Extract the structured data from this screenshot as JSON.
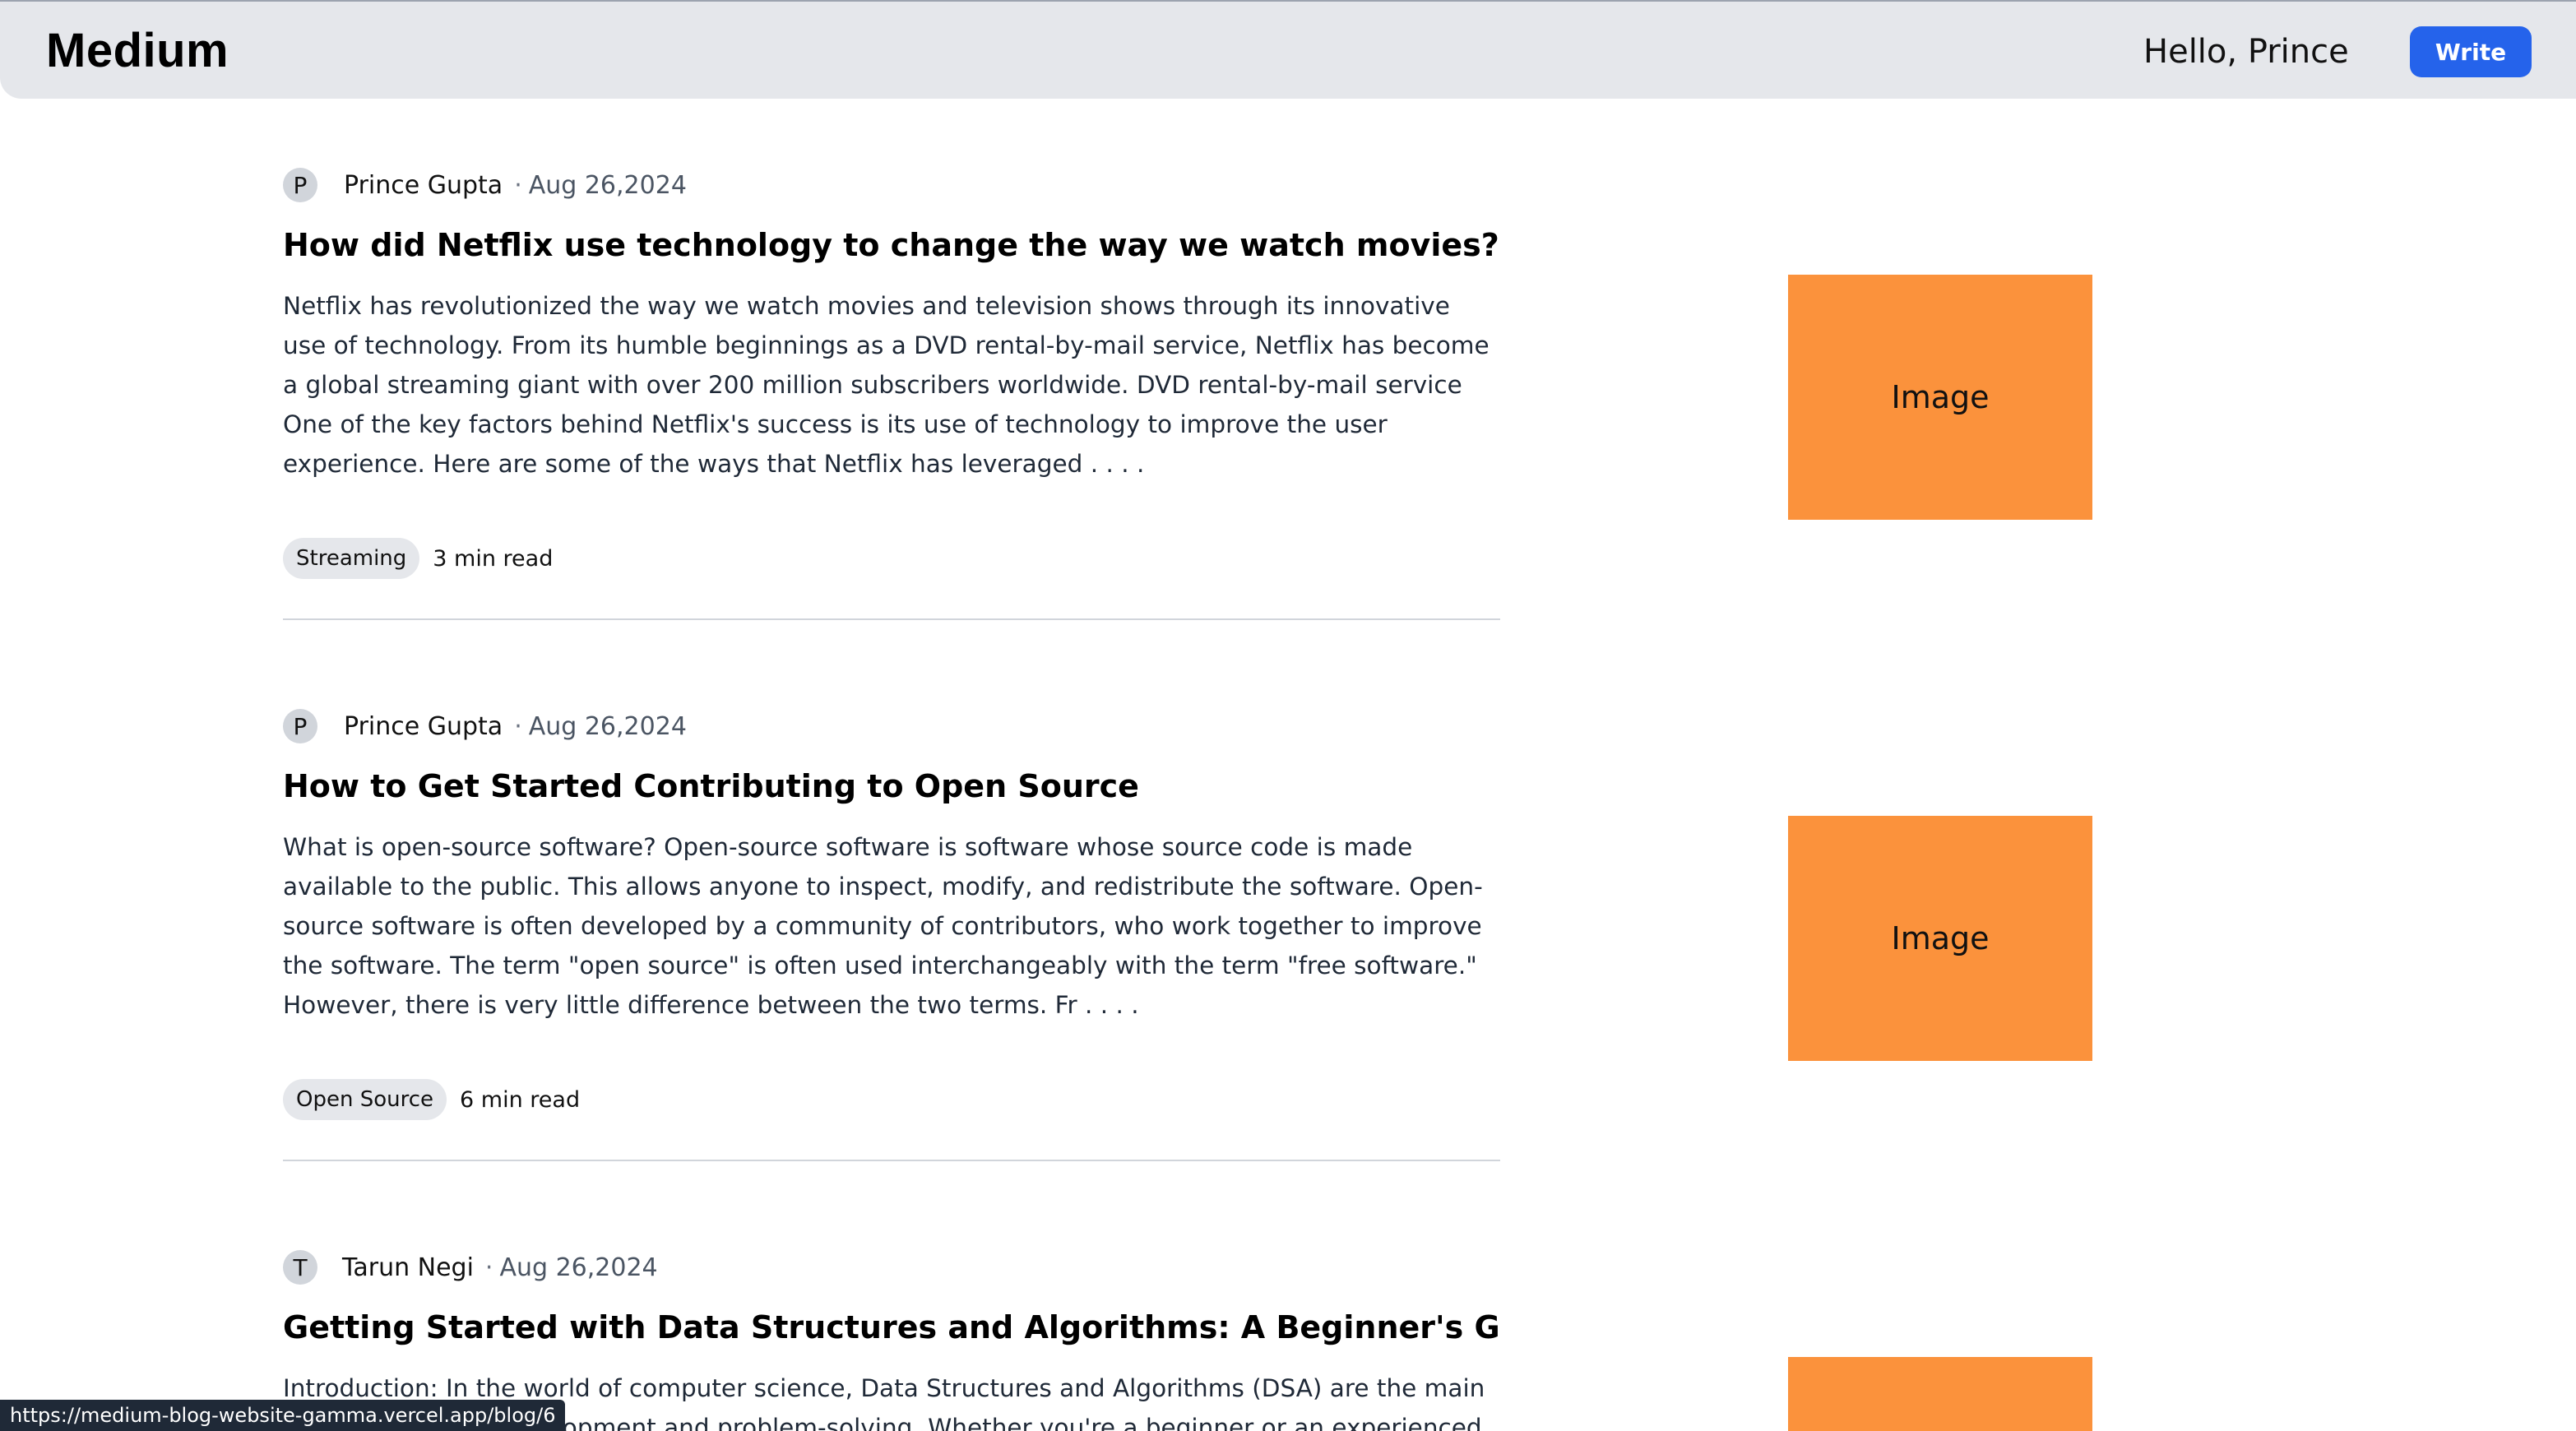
{
  "header": {
    "logo": "Medium",
    "greeting": "Hello, Prince",
    "write_label": "Write"
  },
  "posts": [
    {
      "avatar_initial": "P",
      "author": "Prince Gupta",
      "date": "Aug 26,2024",
      "title": "How did Netflix use technology to change the way we watch movies?",
      "excerpt": "Netflix has revolutionized the way we watch movies and television shows through its innovative use of technology. From its humble beginnings as a DVD rental-by-mail service, Netflix has become a global streaming giant with over 200 million subscribers worldwide. DVD rental-by-mail service One of the key factors behind Netflix's success is its use of technology to improve the user experience. Here are some of the ways that Netflix has leveraged . . . .",
      "tag": "Streaming",
      "read_time": "3 min read",
      "image_label": "Image"
    },
    {
      "avatar_initial": "P",
      "author": "Prince Gupta",
      "date": "Aug 26,2024",
      "title": "How to Get Started Contributing to Open Source",
      "excerpt": "What is open-source software? Open-source software is software whose source code is made available to the public. This allows anyone to inspect, modify, and redistribute the software. Open-source software is often developed by a community of contributors, who work together to improve the software. The term \"open source\" is often used interchangeably with the term \"free software.\" However, there is very little difference between the two terms. Fr . . . .",
      "tag": "Open Source",
      "read_time": "6 min read",
      "image_label": "Image"
    },
    {
      "avatar_initial": "T",
      "author": "Tarun Negi",
      "date": "Aug 26,2024",
      "title": "Getting Started with Data Structures and Algorithms: A Beginner's Guide",
      "excerpt": "Introduction: In the world of computer science, Data Structures and Algorithms (DSA) are the main parts of software development and problem-solving. Whether you're a beginner or an experienced"
    }
  ],
  "status_bar": {
    "url": "https://medium-blog-website-gamma.vercel.app/blog/6"
  },
  "colors": {
    "header_bg": "#e5e7eb",
    "write_button": "#2563eb",
    "thumbnail": "#fb923c"
  }
}
